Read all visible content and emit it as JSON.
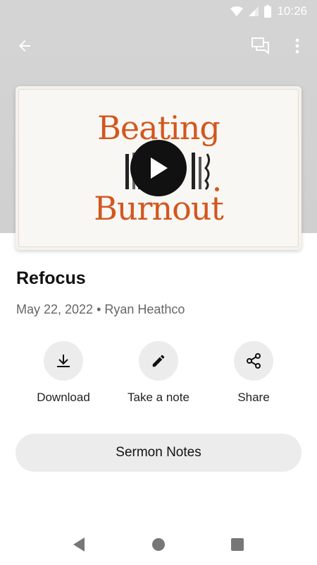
{
  "status_bar": {
    "time": "10:26",
    "icons": [
      "wifi-icon",
      "signal-icon",
      "battery-icon"
    ]
  },
  "app_bar": {
    "back_icon": "arrow-left-icon",
    "chat_icon": "chat-bubbles-icon",
    "menu_icon": "more-vert-icon"
  },
  "media": {
    "art_line1": "Beating",
    "art_line2": "Burnout",
    "play_icon": "play-icon"
  },
  "sermon": {
    "title": "Refocus",
    "meta": "May 22, 2022 • Ryan Heathco"
  },
  "actions": [
    {
      "label": "Download",
      "icon": "download-icon"
    },
    {
      "label": "Take a note",
      "icon": "pencil-icon"
    },
    {
      "label": "Share",
      "icon": "share-icon"
    }
  ],
  "notes_button": {
    "label": "Sermon Notes"
  },
  "nav": {
    "back": "nav-back-icon",
    "home": "nav-home-icon",
    "recents": "nav-recents-icon"
  },
  "colors": {
    "header_bg": "#d4d4d4",
    "accent_orange": "#d2571e",
    "button_bg": "#ececec"
  }
}
